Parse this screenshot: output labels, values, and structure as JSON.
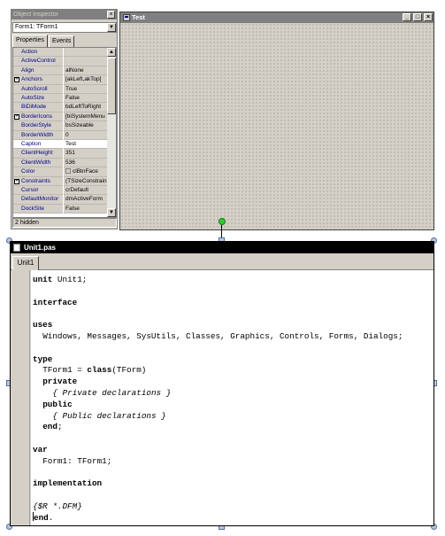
{
  "object_inspector": {
    "title": "Object Inspector",
    "selected_object": "Form1: TForm1",
    "tabs": [
      "Properties",
      "Events"
    ],
    "properties": [
      {
        "name": "Action",
        "value": "",
        "expandable": false
      },
      {
        "name": "ActiveControl",
        "value": "",
        "expandable": false
      },
      {
        "name": "Align",
        "value": "alNone",
        "expandable": false
      },
      {
        "name": "Anchors",
        "value": "[akLeft,akTop]",
        "expandable": true
      },
      {
        "name": "AutoScroll",
        "value": "True",
        "expandable": false
      },
      {
        "name": "AutoSize",
        "value": "False",
        "expandable": false
      },
      {
        "name": "BiDiMode",
        "value": "bdLeftToRight",
        "expandable": false
      },
      {
        "name": "BorderIcons",
        "value": "[biSystemMenu",
        "expandable": true
      },
      {
        "name": "BorderStyle",
        "value": "bsSizeable",
        "expandable": false
      },
      {
        "name": "BorderWidth",
        "value": "0",
        "expandable": false
      },
      {
        "name": "Caption",
        "value": "Test",
        "expandable": false,
        "selected": true
      },
      {
        "name": "ClientHeight",
        "value": "351",
        "expandable": false
      },
      {
        "name": "ClientWidth",
        "value": "536",
        "expandable": false
      },
      {
        "name": "Color",
        "value": "clBtnFace",
        "expandable": false,
        "swatch": true
      },
      {
        "name": "Constraints",
        "value": "(TSizeConstrain",
        "expandable": true
      },
      {
        "name": "Cursor",
        "value": "crDefault",
        "expandable": false
      },
      {
        "name": "DefaultMonitor",
        "value": "dmActiveForm",
        "expandable": false
      },
      {
        "name": "DockSite",
        "value": "False",
        "expandable": false
      }
    ],
    "status": "2 hidden",
    "close_icon": "close-icon"
  },
  "form_designer": {
    "title": "Test",
    "buttons": [
      "minimize",
      "maximize",
      "close"
    ]
  },
  "editor": {
    "title": "Unit1.pas",
    "tab": "Unit1",
    "lines": [
      {
        "row": 0,
        "indent": 0,
        "parts": [
          {
            "t": "unit",
            "s": "kw"
          },
          {
            "t": " Unit1;"
          }
        ]
      },
      {
        "row": 2,
        "indent": 0,
        "parts": [
          {
            "t": "interface",
            "s": "kw"
          }
        ]
      },
      {
        "row": 4,
        "indent": 0,
        "parts": [
          {
            "t": "uses",
            "s": "kw"
          }
        ]
      },
      {
        "row": 5,
        "indent": 1,
        "parts": [
          {
            "t": "Windows, Messages, SysUtils, Classes, Graphics, Controls, Forms, Dialogs;"
          }
        ]
      },
      {
        "row": 7,
        "indent": 0,
        "parts": [
          {
            "t": "type",
            "s": "kw"
          }
        ]
      },
      {
        "row": 8,
        "indent": 1,
        "parts": [
          {
            "t": "TForm1 = "
          },
          {
            "t": "class",
            "s": "kw"
          },
          {
            "t": "(TForm)"
          }
        ]
      },
      {
        "row": 9,
        "indent": 1,
        "parts": [
          {
            "t": "private",
            "s": "kw"
          }
        ]
      },
      {
        "row": 10,
        "indent": 2,
        "parts": [
          {
            "t": "{ Private declarations }",
            "s": "cm"
          }
        ]
      },
      {
        "row": 11,
        "indent": 1,
        "parts": [
          {
            "t": "public",
            "s": "kw"
          }
        ]
      },
      {
        "row": 12,
        "indent": 2,
        "parts": [
          {
            "t": "{ Public declarations }",
            "s": "cm"
          }
        ]
      },
      {
        "row": 13,
        "indent": 1,
        "parts": [
          {
            "t": "end",
            "s": "kw"
          },
          {
            "t": ";"
          }
        ]
      },
      {
        "row": 15,
        "indent": 0,
        "parts": [
          {
            "t": "var",
            "s": "kw"
          }
        ]
      },
      {
        "row": 16,
        "indent": 1,
        "parts": [
          {
            "t": "Form1: TForm1;"
          }
        ]
      },
      {
        "row": 18,
        "indent": 0,
        "parts": [
          {
            "t": "implementation",
            "s": "kw"
          }
        ]
      },
      {
        "row": 20,
        "indent": 0,
        "parts": [
          {
            "t": "{$R *.DFM}",
            "s": "cm"
          }
        ]
      },
      {
        "row": 21,
        "indent": 0,
        "caret": true,
        "parts": [
          {
            "t": "end",
            "s": "kw"
          },
          {
            "t": "."
          }
        ]
      }
    ]
  },
  "colors": {
    "window_face": "#d4d0c8",
    "inactive_title": "#808080",
    "editor_title": "#000000",
    "selection_handle": "#b8c8e0",
    "connector_dot": "#2ecc2e"
  }
}
